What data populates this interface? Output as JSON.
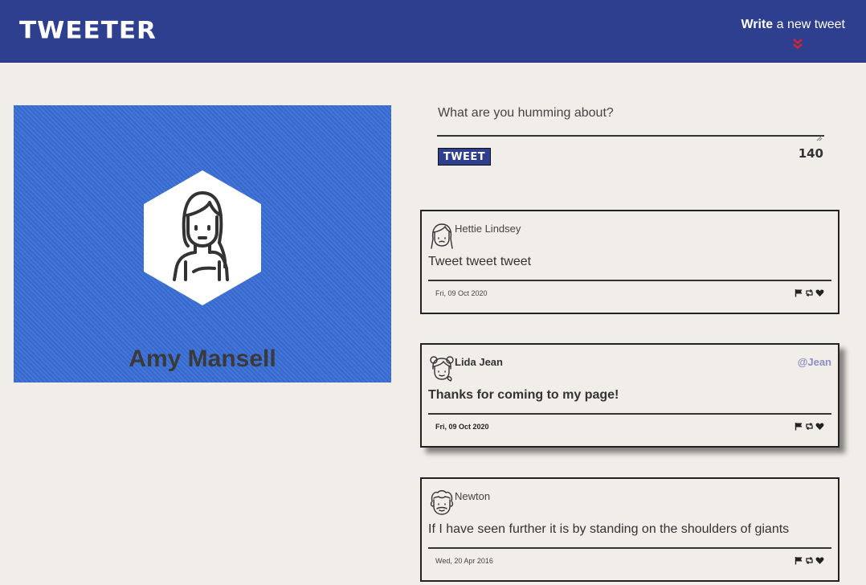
{
  "nav": {
    "brand": "TWEETER",
    "write_bold": "Write",
    "write_rest": " a new tweet",
    "chevron_icon": "double-chevron-down-icon",
    "accent": "#c8273a",
    "bar_color": "#2f3f8f"
  },
  "profile": {
    "name": "Amy Mansell",
    "avatar_icon": "woman-avatar-icon",
    "background": "#3a6fd8"
  },
  "composer": {
    "placeholder": "What are you humming about?",
    "value": "",
    "submit_label": "TWEET",
    "counter": "140"
  },
  "tweets": [
    {
      "name": "Hettie Lindsey",
      "handle": "",
      "text": "Tweet tweet tweet",
      "date": "Fri, 09 Oct 2020",
      "avatar_icon": "girl-avatar-icon",
      "hovered": false
    },
    {
      "name": "Lida Jean",
      "handle": "@Jean",
      "text": "Thanks for coming to my page!",
      "date": "Fri, 09 Oct 2020",
      "avatar_icon": "girl-buns-avatar-icon",
      "hovered": true
    },
    {
      "name": "Newton",
      "handle": "",
      "text": "If I have seen further it is by standing on the shoulders of giants",
      "date": "Wed, 20 Apr 2016",
      "avatar_icon": "man-avatar-icon",
      "hovered": false
    }
  ],
  "tweet_action_icons": [
    "flag-icon",
    "retweet-icon",
    "heart-icon"
  ]
}
